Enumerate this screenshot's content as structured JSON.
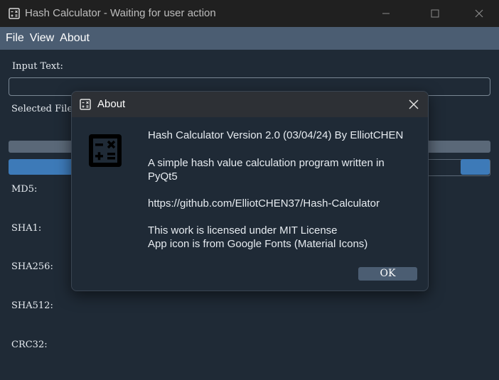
{
  "window": {
    "title": "Hash Calculator - Waiting for user action"
  },
  "menu": [
    {
      "label": "File"
    },
    {
      "label": "View"
    },
    {
      "label": "About"
    }
  ],
  "main": {
    "input_label": "Input Text:",
    "input_value": "",
    "selected_file_label": "Selected File:",
    "hashes": [
      {
        "label": "MD5:"
      },
      {
        "label": "SHA1:"
      },
      {
        "label": "SHA256:"
      },
      {
        "label": "SHA512:"
      },
      {
        "label": "CRC32:"
      }
    ]
  },
  "dialog": {
    "title": "About",
    "line1": "Hash Calculator Version 2.0 (03/04/24) By ElliotCHEN",
    "line2a": "A simple hash value calculation program written in",
    "line2b": "PyQt5",
    "line3": "https://github.com/ElliotCHEN37/Hash-Calculator",
    "line4a": "This work is licensed under MIT License",
    "line4b": "App icon is from Google Fonts (Material Icons)",
    "ok_label": "OK"
  },
  "colors": {
    "background": "#1f2a36",
    "menubar": "#4b5d72",
    "accent": "#3d7ab8",
    "titlebar": "#202020"
  },
  "icons": [
    "calculator-icon",
    "minimize-icon",
    "maximize-icon",
    "close-icon"
  ]
}
